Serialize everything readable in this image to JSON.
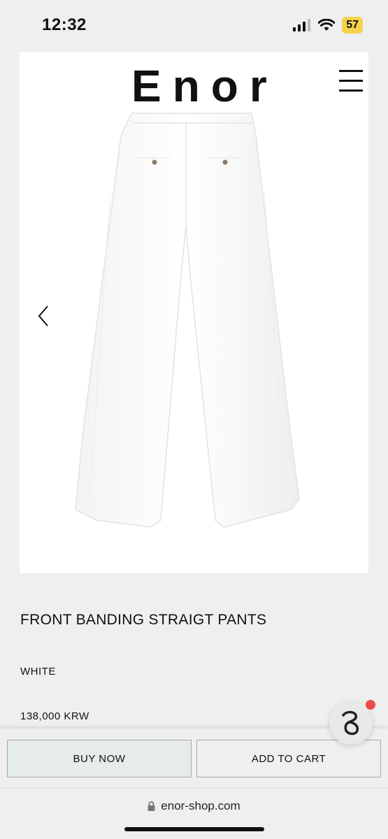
{
  "status_bar": {
    "time": "12:32",
    "battery": "57"
  },
  "header": {
    "logo": "Enor"
  },
  "product": {
    "name": "FRONT BANDING STRAIGT PANTS",
    "color": "WHITE",
    "price": "138,000 KRW"
  },
  "actions": {
    "buy_now": "BUY NOW",
    "add_to_cart": "ADD TO CART"
  },
  "browser": {
    "url": "enor-shop.com"
  },
  "colors": {
    "page_bg": "#efefef",
    "card_bg": "#ffffff",
    "buy_bg": "#e6ece8",
    "notification": "#ec4a4a",
    "battery": "#f6d24a"
  },
  "icons": [
    "cellular-signal-icon",
    "wifi-icon",
    "battery-icon",
    "menu-icon",
    "chevron-left-icon",
    "chat-icon",
    "lock-icon"
  ]
}
